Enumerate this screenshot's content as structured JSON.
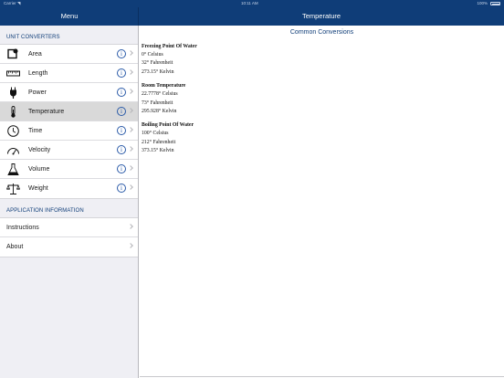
{
  "status_bar": {
    "carrier": "Carrier ◥",
    "time": "10:11 AM",
    "battery": "100%"
  },
  "nav": {
    "menu_title": "Menu",
    "detail_title": "Temperature"
  },
  "sidebar": {
    "unit_header": "UNIT CONVERTERS",
    "converters": [
      {
        "label": "Area",
        "icon": "area-icon"
      },
      {
        "label": "Length",
        "icon": "ruler-icon"
      },
      {
        "label": "Power",
        "icon": "plug-icon"
      },
      {
        "label": "Temperature",
        "icon": "thermometer-icon",
        "selected": true
      },
      {
        "label": "Time",
        "icon": "clock-icon"
      },
      {
        "label": "Velocity",
        "icon": "speedometer-icon"
      },
      {
        "label": "Volume",
        "icon": "flask-icon"
      },
      {
        "label": "Weight",
        "icon": "scale-icon"
      }
    ],
    "info_glyph": "i",
    "app_header": "APPLICATION INFORMATION",
    "app_items": [
      {
        "label": "Instructions"
      },
      {
        "label": "About"
      }
    ]
  },
  "content": {
    "title": "Common Conversions",
    "blocks": [
      {
        "title": "Freezing Point Of Water",
        "lines": [
          "0° Celsius",
          "32° Fahrenheit",
          "273.15° Kelvin"
        ]
      },
      {
        "title": "Room Temperature",
        "lines": [
          "22.7778° Celsius",
          "73° Fahrenheit",
          "295.928° Kelvin"
        ]
      },
      {
        "title": "Boiling Point Of Water",
        "lines": [
          "100° Celsius",
          "212° Fahrenheit",
          "373.15° Kelvin"
        ]
      }
    ]
  },
  "colors": {
    "nav_bg": "#0f3d78",
    "header_text": "#0f3d78",
    "info_blue": "#2a5aa8",
    "selected_row": "#d9d9d9"
  }
}
